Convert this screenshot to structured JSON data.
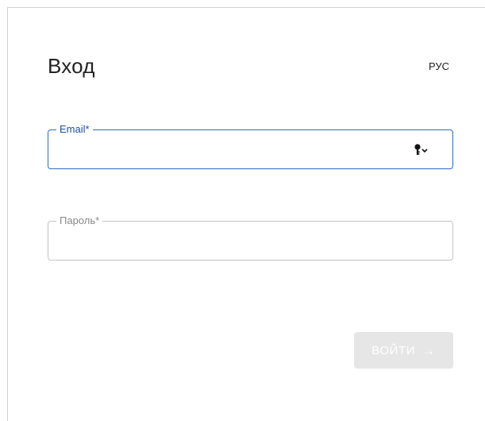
{
  "login": {
    "title": "Вход",
    "language": "РУС",
    "email": {
      "label": "Email*",
      "value": "",
      "placeholder": ""
    },
    "password": {
      "label": "Пароль*",
      "value": "",
      "placeholder": ""
    },
    "submit_label": "ВОЙТИ",
    "submit_arrow": "→",
    "submit_disabled": true
  },
  "icons": {
    "password_manager": "key-dropdown-icon"
  },
  "colors": {
    "accent": "#2b6cc4",
    "label_active": "#1f4fa3",
    "label_inactive": "#8a8a8a",
    "border_inactive": "#c4c4c4",
    "button_disabled_bg": "#e6e6e6"
  }
}
